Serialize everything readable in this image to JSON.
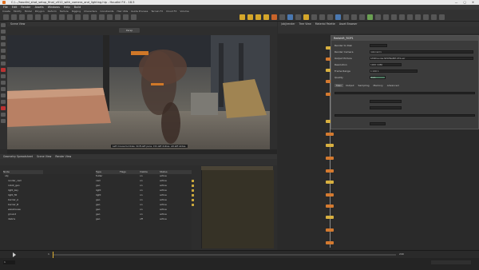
{
  "window": {
    "title": "C:/.../houdini_shot_setup_final_v012_with_camera_and_lighting.hip - Houdini FX - 18.5",
    "controls": "— ▢ ✕"
  },
  "menubar": [
    "File",
    "Edit",
    "Render",
    "Assets",
    "Windows",
    "Help",
    "Build"
  ],
  "shelf_tabs": [
    "Create",
    "Modify",
    "Model",
    "Polygon",
    "Deform",
    "Texture",
    "Rigging",
    "Characters",
    "Constraints",
    "Hair Utils",
    "Guide Process",
    "Terrain FX",
    "Cloud FX",
    "Volume"
  ],
  "viewport": {
    "tab": "Scene View",
    "camera_label": "Persp",
    "status_text": "Left mouse tumbles. Shift-left pans. Ctrl-left dollies. Alt-left slides."
  },
  "param_tabs": [
    "/obj/render",
    "Tree View",
    "Material Palette",
    "Asset Browser"
  ],
  "parameters": {
    "node_name": "Redshift_ROP1",
    "rows": [
      {
        "label": "Render to Disk",
        "value": ""
      },
      {
        "label": "Render Camera",
        "value": "/obj/cam1"
      },
      {
        "label": "Output Picture",
        "value": "$HIP/render/$HIPNAME.$F4.exr"
      },
      {
        "label": "Resolution",
        "value": "1920 1080"
      },
      {
        "label": "Frame Range",
        "value": "1 240 1"
      },
      {
        "label": "Quality",
        "value": "High"
      }
    ],
    "sections": [
      "Main",
      "Output",
      "Sampling",
      "Memory",
      "Advanced"
    ]
  },
  "spreadsheet": {
    "tabs": [
      "Geometry Spreadsheet",
      "Scene View",
      "Render View"
    ],
    "columns": [
      "Node",
      "Type",
      "Flags",
      "Visible",
      "Status"
    ],
    "rows": [
      [
        "obj",
        "folder",
        "",
        "on",
        "active"
      ],
      [
        "render_cam",
        "cam",
        "",
        "on",
        "active"
      ],
      [
        "robot_geo",
        "geo",
        "",
        "on",
        "active"
      ],
      [
        "light_key",
        "light",
        "",
        "on",
        "active"
      ],
      [
        "light_fill",
        "light",
        "",
        "on",
        "active"
      ],
      [
        "barrier_A",
        "geo",
        "",
        "on",
        "active"
      ],
      [
        "barrier_B",
        "geo",
        "",
        "on",
        "active"
      ],
      [
        "warehouse",
        "geo",
        "",
        "on",
        "active"
      ],
      [
        "ground",
        "geo",
        "",
        "on",
        "active"
      ],
      [
        "debris",
        "geo",
        "",
        "off",
        "active"
      ]
    ]
  },
  "timeline": {
    "start": "1",
    "end": "240",
    "current": "1"
  }
}
